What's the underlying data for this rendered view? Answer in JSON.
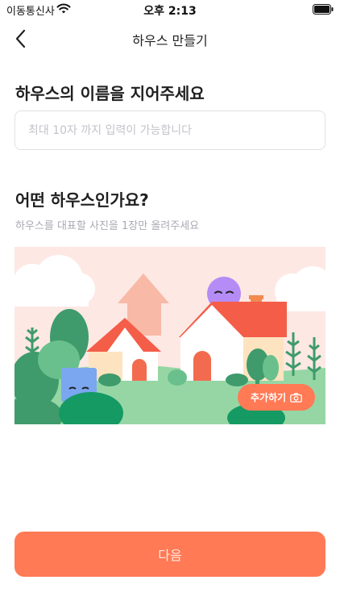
{
  "status_bar": {
    "carrier": "이동통신사",
    "time": "오후 2:13"
  },
  "header": {
    "title": "하우스 만들기"
  },
  "name_section": {
    "title": "하우스의 이름을 지어주세요",
    "input_value": "",
    "input_placeholder": "최대 10자 까지 입력이 가능합니다"
  },
  "kind_section": {
    "title": "어떤 하우스인가요?",
    "subtitle": "하우스를 대표할 사진을 1장만 올려주세요",
    "add_photo_label": "추가하기"
  },
  "footer": {
    "next_label": "다음"
  },
  "colors": {
    "accent": "#ff7a55",
    "sky": "#fde8e4",
    "grass": "#96d6a5",
    "tree": "#3f9b6b"
  },
  "icons": [
    "wifi-icon",
    "battery-icon",
    "back-chevron-icon",
    "camera-icon"
  ]
}
